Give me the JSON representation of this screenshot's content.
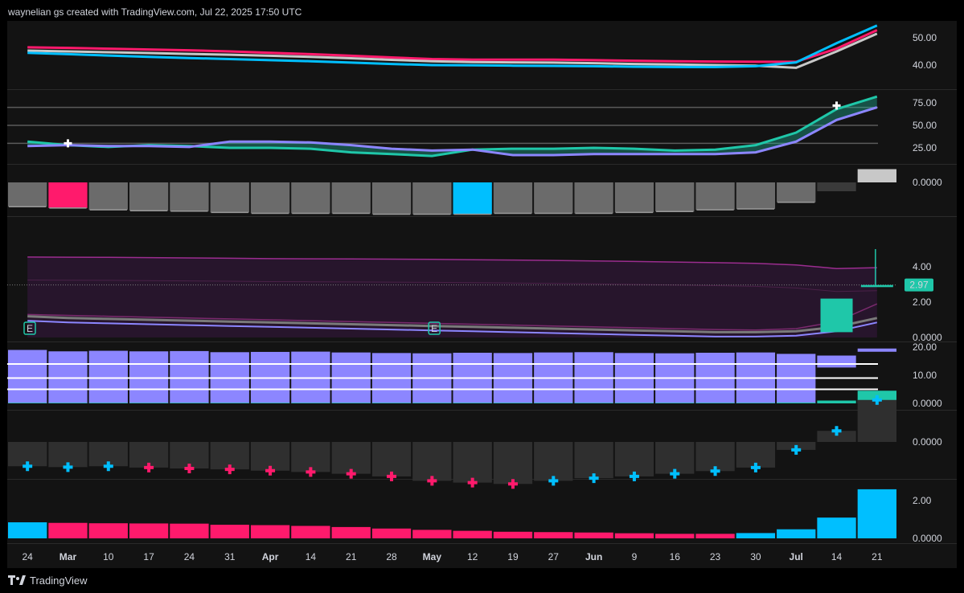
{
  "header": {
    "text": "waynelian gs created with TradingView.com, Jul 22, 2025 17:50 UTC"
  },
  "footer": {
    "logo_text": "TradingView"
  },
  "colors": {
    "background": "#000000",
    "panel": "#131313",
    "pink": "#ff1a6c",
    "cyan": "#00bfff",
    "silver": "#c8c8c8",
    "teal": "#1fc7a9",
    "violet": "#8c86ff",
    "gray_bar": "#6b6b6b",
    "dark_bar": "#2f2f2f"
  },
  "chart_data": {
    "type": "composite",
    "x_dates": [
      "24",
      "Mar",
      "10",
      "17",
      "24",
      "31",
      "Apr",
      "14",
      "21",
      "28",
      "May",
      "12",
      "19",
      "27",
      "Jun",
      "9",
      "16",
      "23",
      "30",
      "Jul",
      "14",
      "21"
    ],
    "x_dates_bold": [
      false,
      true,
      false,
      false,
      false,
      false,
      true,
      false,
      false,
      false,
      true,
      false,
      false,
      false,
      true,
      false,
      false,
      false,
      false,
      true,
      false,
      false
    ],
    "panels": [
      {
        "id": "ma-lines",
        "type": "line",
        "y_ticks": [
          "50.00",
          "40.00"
        ],
        "series": [
          {
            "color": "#ff1a6c",
            "values": [
              46.5,
              46.3,
              46,
              45.7,
              45.4,
              45,
              44.5,
              44,
              43.4,
              42.8,
              42.2,
              42,
              42,
              42,
              41.8,
              41.6,
              41.4,
              41.3,
              41.2,
              41.2,
              46,
              52.8
            ]
          },
          {
            "color": "#c8c8c8",
            "values": [
              45.3,
              45,
              44.7,
              44.4,
              44.1,
              43.8,
              43.4,
              43,
              42.5,
              41.9,
              41.4,
              41.1,
              41,
              40.9,
              40.7,
              40.4,
              40.2,
              40,
              39.8,
              39,
              45,
              51.5
            ]
          },
          {
            "color": "#00bfff",
            "values": [
              44.5,
              44,
              43.5,
              43,
              42.6,
              42.2,
              41.8,
              41.4,
              40.9,
              40.4,
              40,
              39.9,
              39.8,
              39.7,
              39.6,
              39.4,
              39.3,
              39.3,
              39.6,
              41,
              48,
              54.5
            ]
          }
        ]
      },
      {
        "id": "rsi-lines",
        "type": "line",
        "y_ticks": [
          "75.00",
          "50.00",
          "25.00"
        ],
        "levels": [
          70,
          50,
          30
        ],
        "series": [
          {
            "color": "#1fc7a9",
            "values": [
              32,
              28,
              26,
              28,
              27,
              25,
              25,
              24,
              20,
              18,
              16,
              23,
              24,
              24,
              25,
              24,
              22,
              23,
              28,
              42,
              68,
              82
            ]
          },
          {
            "color": "#8c86ff",
            "values": [
              27,
              28,
              27,
              27,
              26,
              32,
              32,
              31,
              28,
              24,
              22,
              23,
              17,
              17,
              18,
              18,
              18,
              18,
              20,
              32,
              56,
              70
            ]
          }
        ],
        "markers": [
          {
            "index": 1,
            "value": 30,
            "symbol": "+"
          },
          {
            "index": 20,
            "value": 72,
            "symbol": "+"
          }
        ]
      },
      {
        "id": "histogram-gray",
        "type": "bar",
        "y_ticks": [
          "0.0000"
        ],
        "values": [
          -0.55,
          -0.58,
          -0.62,
          -0.64,
          -0.65,
          -0.68,
          -0.7,
          -0.7,
          -0.7,
          -0.72,
          -0.72,
          -0.72,
          -0.7,
          -0.7,
          -0.7,
          -0.68,
          -0.66,
          -0.62,
          -0.6,
          -0.45,
          -0.2,
          0.3
        ],
        "bar_colors": [
          "#6b6b6b",
          "#ff1a6c",
          "#6b6b6b",
          "#6b6b6b",
          "#6b6b6b",
          "#6b6b6b",
          "#6b6b6b",
          "#6b6b6b",
          "#6b6b6b",
          "#6b6b6b",
          "#6b6b6b",
          "#00bfff",
          "#6b6b6b",
          "#6b6b6b",
          "#6b6b6b",
          "#6b6b6b",
          "#6b6b6b",
          "#6b6b6b",
          "#6b6b6b",
          "#6b6b6b",
          "#3a3a3a",
          "#c8c8c8"
        ]
      },
      {
        "id": "bands",
        "type": "area",
        "y_ticks": [
          "4.00",
          "2.00",
          "0.0000"
        ],
        "price_label": "2.97",
        "candles": [
          {
            "index": 20,
            "open": 0.3,
            "close": 2.2,
            "color": "#1fc7a9"
          },
          {
            "index": 21,
            "open": 2.97,
            "close": 2.85,
            "high": 5.0,
            "color": "#1fc7a9"
          }
        ],
        "low_line": [
          1.2,
          1.1,
          1.05,
          1,
          0.95,
          0.9,
          0.85,
          0.8,
          0.75,
          0.7,
          0.65,
          0.6,
          0.55,
          0.5,
          0.45,
          0.4,
          0.35,
          0.3,
          0.3,
          0.35,
          0.6,
          1.1
        ],
        "earnings_markers": [
          0,
          10
        ]
      },
      {
        "id": "volume-bars",
        "type": "bar",
        "y_ticks": [
          "20.00",
          "10.00",
          "0.0000"
        ],
        "values": [
          19,
          18.5,
          18.7,
          18.5,
          18.6,
          18.2,
          18.3,
          18.4,
          18.1,
          17.9,
          17.8,
          18,
          17.9,
          18.1,
          18.2,
          17.9,
          17.8,
          18,
          18.1,
          17.6,
          17,
          19.5
        ],
        "teal_values": [
          0.2,
          0.2,
          0.2,
          0.2,
          0.2,
          0.2,
          0.2,
          0.2,
          0.2,
          0.2,
          0.2,
          0.2,
          0.2,
          0.2,
          0.2,
          0.2,
          0.2,
          0.2,
          0.2,
          0.3,
          1,
          4.5
        ],
        "levels": [
          14,
          9,
          5
        ]
      },
      {
        "id": "momentum",
        "type": "bar",
        "y_ticks": [
          "0.0000"
        ],
        "values": [
          -0.55,
          -0.57,
          -0.55,
          -0.58,
          -0.6,
          -0.62,
          -0.65,
          -0.68,
          -0.72,
          -0.78,
          -0.88,
          -0.92,
          -0.95,
          -0.88,
          -0.82,
          -0.78,
          -0.72,
          -0.66,
          -0.58,
          -0.18,
          0.25,
          0.95
        ],
        "marker_colors": [
          "#00bfff",
          "#00bfff",
          "#00bfff",
          "#ff1a6c",
          "#ff1a6c",
          "#ff1a6c",
          "#ff1a6c",
          "#ff1a6c",
          "#ff1a6c",
          "#ff1a6c",
          "#ff1a6c",
          "#ff1a6c",
          "#ff1a6c",
          "#00bfff",
          "#00bfff",
          "#00bfff",
          "#00bfff",
          "#00bfff",
          "#00bfff",
          "#00bfff",
          "#00bfff",
          "#00bfff"
        ]
      },
      {
        "id": "bottom-bars",
        "type": "bar",
        "y_ticks": [
          "2.00",
          "0.0000"
        ],
        "values": [
          0.85,
          0.82,
          0.8,
          0.79,
          0.78,
          0.72,
          0.7,
          0.66,
          0.6,
          0.52,
          0.45,
          0.4,
          0.35,
          0.33,
          0.31,
          0.27,
          0.24,
          0.24,
          0.28,
          0.48,
          1.1,
          2.6
        ],
        "bar_colors": [
          "#00bfff",
          "#ff1a6c",
          "#ff1a6c",
          "#ff1a6c",
          "#ff1a6c",
          "#ff1a6c",
          "#ff1a6c",
          "#ff1a6c",
          "#ff1a6c",
          "#ff1a6c",
          "#ff1a6c",
          "#ff1a6c",
          "#ff1a6c",
          "#ff1a6c",
          "#ff1a6c",
          "#ff1a6c",
          "#ff1a6c",
          "#ff1a6c",
          "#00bfff",
          "#00bfff",
          "#00bfff",
          "#00bfff"
        ],
        "ylim": [
          0,
          2.8
        ]
      }
    ]
  }
}
